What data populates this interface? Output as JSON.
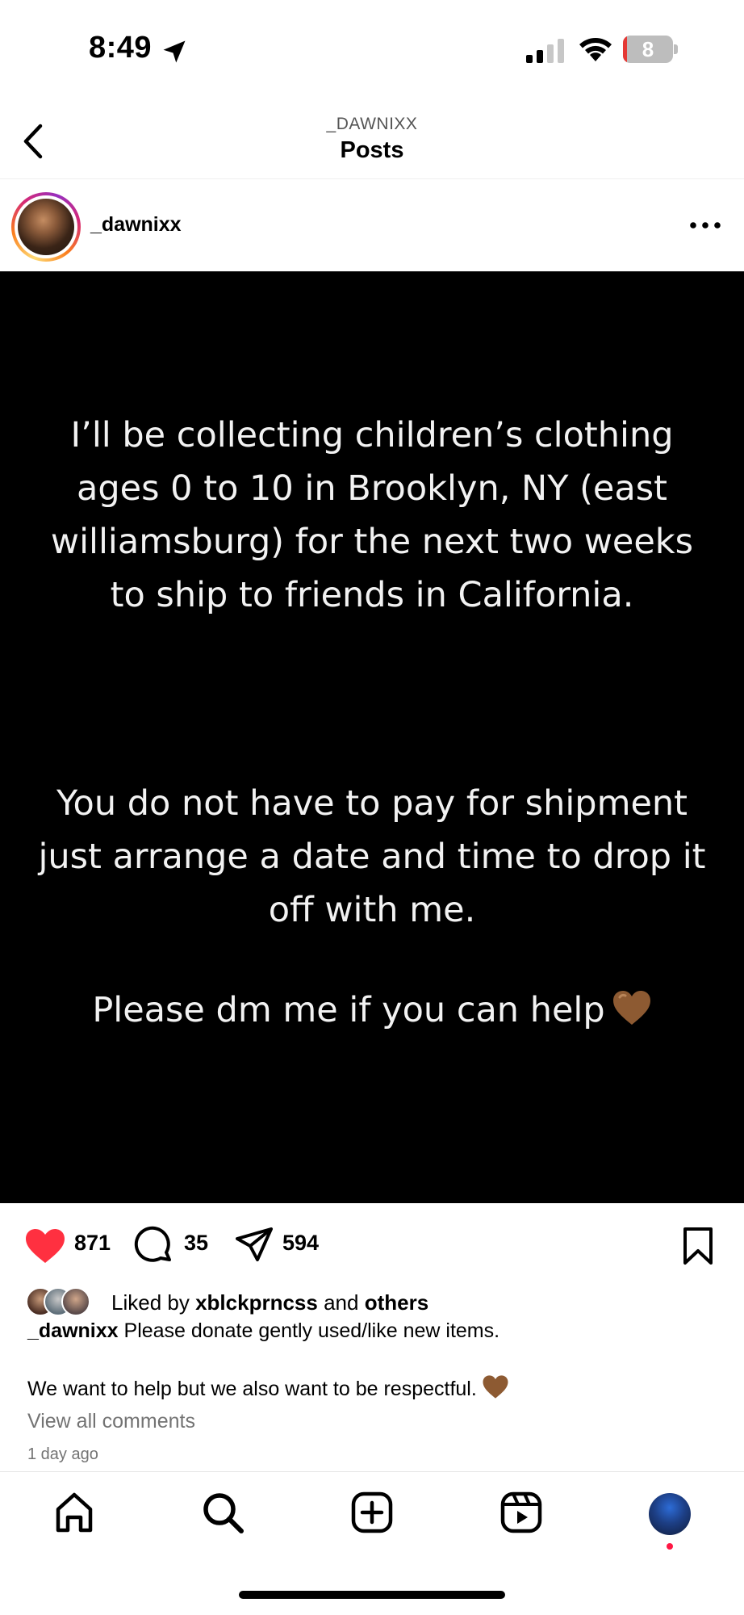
{
  "status_bar": {
    "time": "8:49",
    "battery_level": "8",
    "battery_fraction": 0.08,
    "icons": [
      "location-arrow-icon",
      "cellular-signal-icon",
      "wifi-icon",
      "battery-icon"
    ]
  },
  "header": {
    "subtitle": "_DAWNIXX",
    "title": "Posts",
    "back_icon": "chevron-left-icon"
  },
  "post": {
    "username": "_dawnixx",
    "more_icon": "ellipsis-icon",
    "image_text": {
      "paragraph_1": "I’ll be collecting children’s clothing ages 0 to 10 in Brooklyn, NY (east williamsburg) for the next two weeks to ship to friends in California.",
      "paragraph_2": "You do not have to pay for shipment just arrange a date and time to drop it off with me.",
      "paragraph_3": "Please dm me if you can help"
    },
    "actions": {
      "like_count": "871",
      "comment_count": "35",
      "share_count": "594"
    },
    "liked_by": {
      "prefix": "Liked by",
      "user": "xblckprncss",
      "conjunction": "and",
      "others": "others"
    },
    "caption": {
      "username": "_dawnixx",
      "line_1": "Please donate gently used/like new items.",
      "line_2": "We want to help but we also want to be respectful."
    },
    "view_comments": "View all comments",
    "timestamp": "1 day ago"
  },
  "colors": {
    "like_red": "#ff3040",
    "brown_heart": "#8d5a32",
    "muted_text": "#737373",
    "battery_red": "#e53935"
  },
  "tab_bar": {
    "icons": [
      "home-icon",
      "search-icon",
      "create-icon",
      "reels-icon",
      "profile-avatar"
    ]
  }
}
